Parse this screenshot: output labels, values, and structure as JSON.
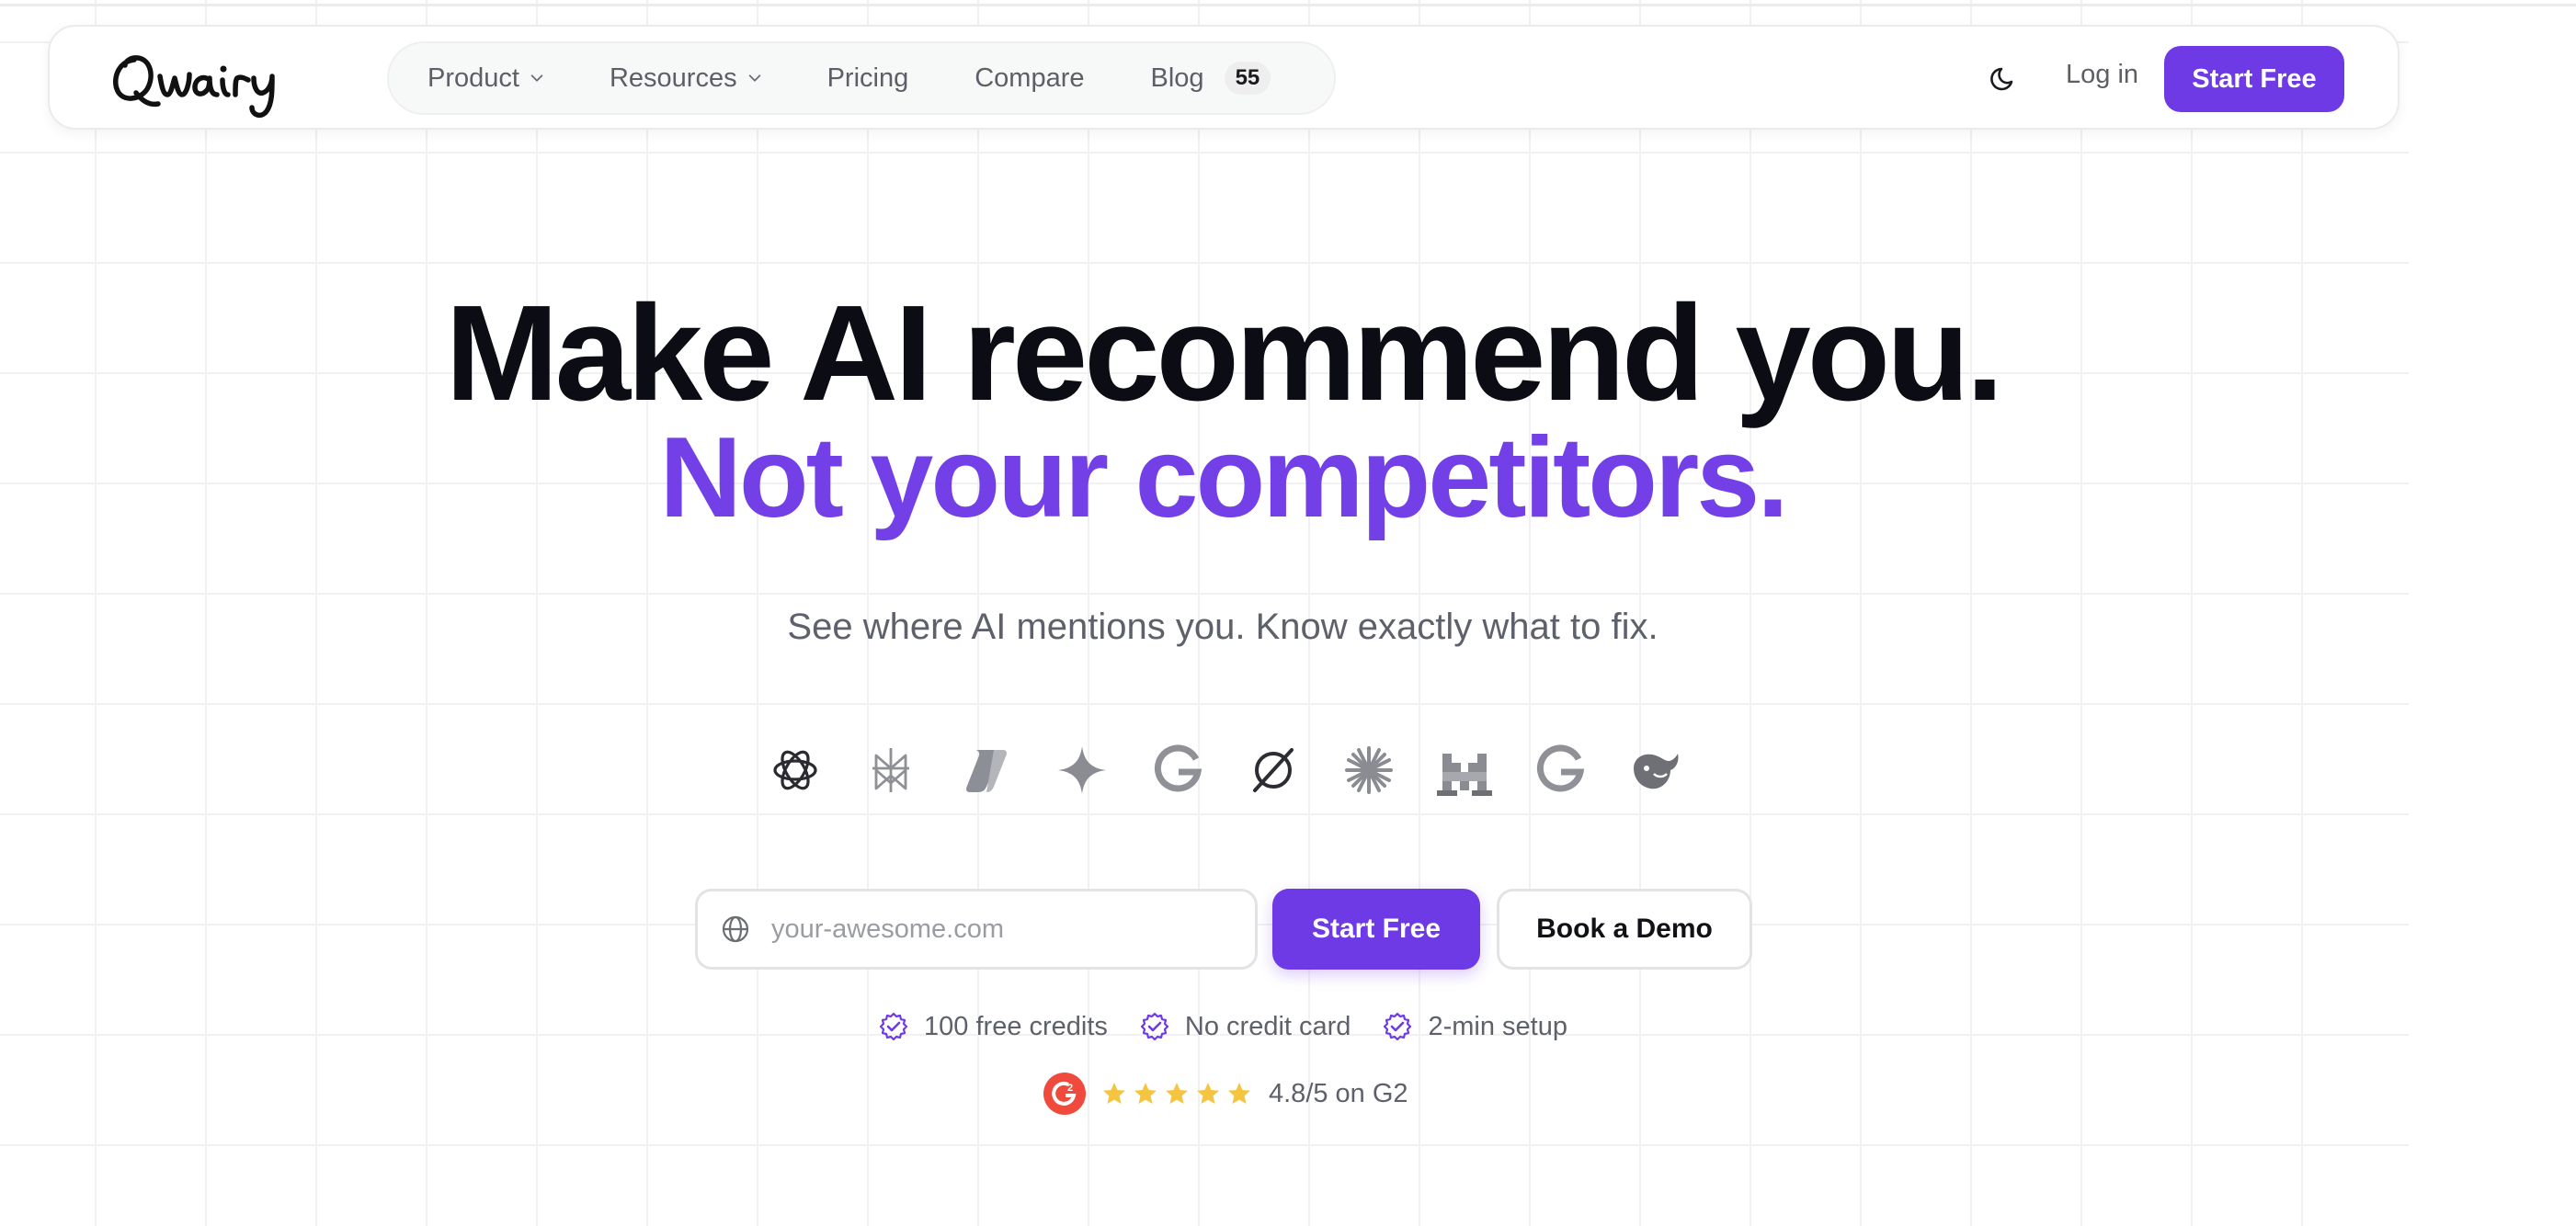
{
  "brand": {
    "name": "Qwairy",
    "accent": "#6e3ae6",
    "headline_purple": "#7340e8"
  },
  "nav": {
    "items": [
      {
        "label": "Product",
        "has_dropdown": true
      },
      {
        "label": "Resources",
        "has_dropdown": true
      },
      {
        "label": "Pricing",
        "has_dropdown": false
      },
      {
        "label": "Compare",
        "has_dropdown": false
      },
      {
        "label": "Blog",
        "badge": "55"
      }
    ],
    "theme_toggle_icon": "moon-icon",
    "login_label": "Log in",
    "start_label": "Start Free"
  },
  "hero": {
    "headline_line1": "Make AI recommend you.",
    "headline_line2": "Not your competitors.",
    "subtitle": "See where AI mentions you. Know exactly what to fix."
  },
  "ai_providers": [
    "openai-icon",
    "perplexity-icon",
    "copilot-icon",
    "gemini-icon",
    "google-icon",
    "grok-icon",
    "claude-icon",
    "mistral-icon",
    "google-ai-mode-icon",
    "deepseek-icon"
  ],
  "cta": {
    "url_placeholder": "your-awesome.com",
    "url_value": "",
    "start_label": "Start Free",
    "demo_label": "Book a Demo"
  },
  "perks": [
    "100 free credits",
    "No credit card",
    "2-min setup"
  ],
  "rating": {
    "stars": 5,
    "text": "4.8/5 on G2",
    "star_color": "#f5c542",
    "g2_color": "#ef4a3c"
  }
}
